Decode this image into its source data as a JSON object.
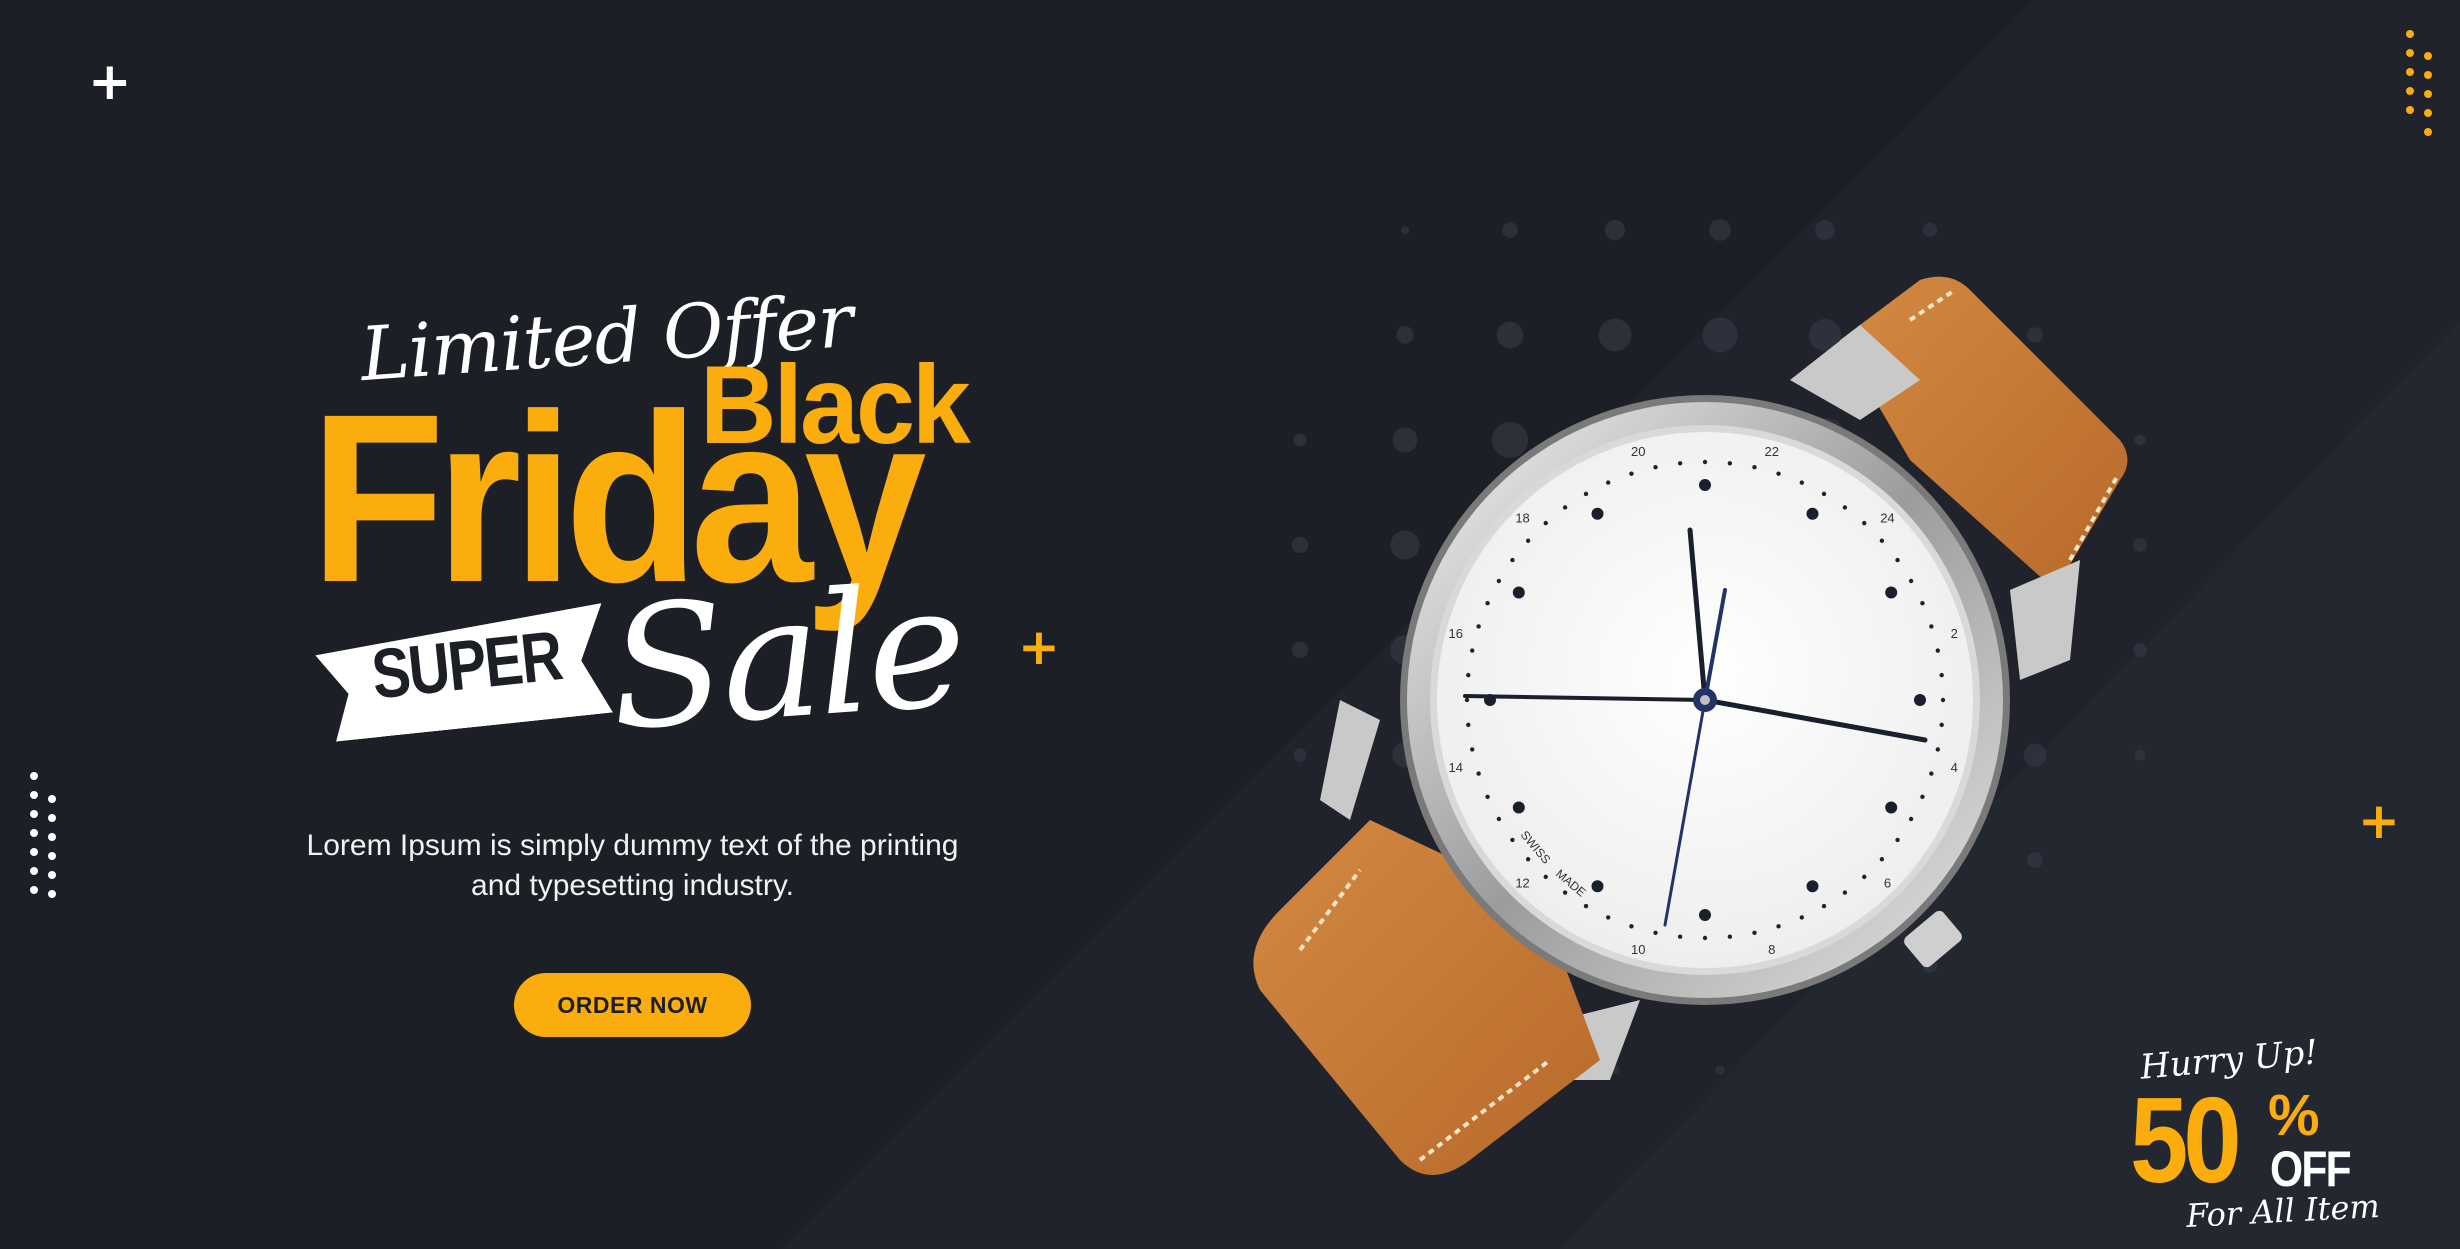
{
  "colors": {
    "background": "#1c1f26",
    "accent": "#fbad0e",
    "text": "#ffffff"
  },
  "headline": {
    "limited": "Limited Offer",
    "black": "Black",
    "friday": "Friday",
    "super": "SUPER",
    "sale": "Sale"
  },
  "description": "Lorem Ipsum is simply dummy text of the printing and typesetting industry.",
  "cta": {
    "label": "ORDER NOW"
  },
  "watch": {
    "dial_numbers": [
      "20",
      "22",
      "24",
      "2",
      "4",
      "6",
      "8",
      "10",
      "12",
      "14",
      "16",
      "18"
    ],
    "dial_text": [
      "SWISS",
      "MADE"
    ]
  },
  "promo": {
    "hurry": "Hurry Up!",
    "percent_value": "50",
    "percent_sign": "%",
    "off": "OFF",
    "subtitle": "For All Item"
  },
  "icons": [
    "plus-icon",
    "watch-image"
  ]
}
